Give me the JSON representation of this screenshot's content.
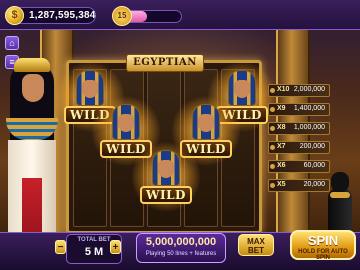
{
  "header": {
    "coins": "1,287,595,384",
    "coin_icon": "coin-icon",
    "level": "15",
    "xp_progress": 0.45
  },
  "side_buttons": [
    {
      "icon": "home-icon",
      "glyph": "⌂"
    },
    {
      "icon": "menu-icon",
      "glyph": "≡"
    }
  ],
  "game": {
    "title": "EGYPTIAN",
    "wild_label": "WILD"
  },
  "paytable": [
    {
      "mult": "X10",
      "amount": "2,000,000"
    },
    {
      "mult": "X9",
      "amount": "1,400,000"
    },
    {
      "mult": "X8",
      "amount": "1,000,000"
    },
    {
      "mult": "X7",
      "amount": "200,000"
    },
    {
      "mult": "X6",
      "amount": "60,000"
    },
    {
      "mult": "X5",
      "amount": "20,000"
    }
  ],
  "bottom": {
    "total_bet_label": "TOTAL BET",
    "total_bet_value": "5 M",
    "minus": "−",
    "plus": "+",
    "jackpot_value": "5,000,000,000",
    "jackpot_sub": "Playing 50 lines + features",
    "max_bet_line1": "MAX",
    "max_bet_line2": "BET",
    "spin_label": "SPIN",
    "spin_sub": "HOLD FOR AUTO SPIN"
  },
  "colors": {
    "accent_purple": "#8a5cd0",
    "gold": "#ffd060",
    "xp_pink": "#e05aa8"
  }
}
